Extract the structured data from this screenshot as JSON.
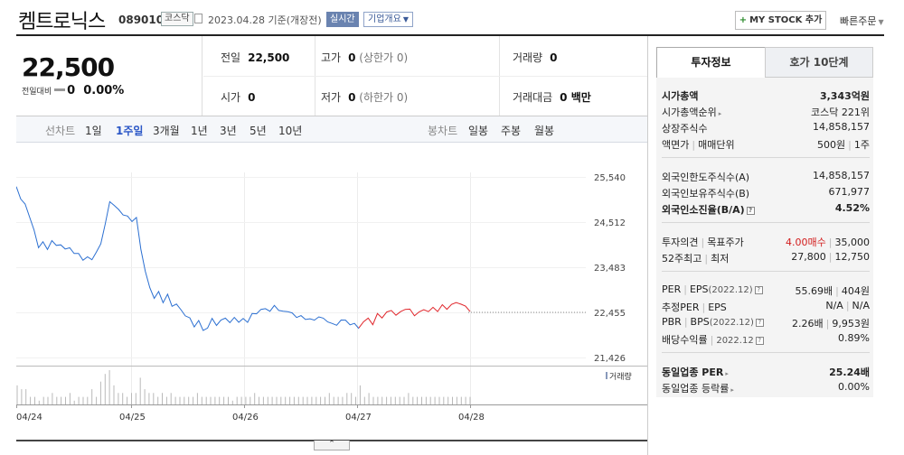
{
  "header": {
    "title": "켐트로닉스",
    "code": "089010",
    "market": "코스닥",
    "date": "2023.04.28 기준(개장전)",
    "realtime": "실시간",
    "corp_info": "기업개요",
    "mystock": "MY STOCK 추가",
    "quick": "빠른주문"
  },
  "summary": {
    "price": "22,500",
    "change_label": "전일대비",
    "change_value": "0",
    "change_pct": "0.00%",
    "prev_label": "전일",
    "prev": "22,500",
    "high_label": "고가",
    "high": "0",
    "high_sub": "(상한가 0)",
    "volume_label": "거래량",
    "volume": "0",
    "open_label": "시가",
    "open": "0",
    "low_label": "저가",
    "low": "0",
    "low_sub": "(하한가 0)",
    "amount_label": "거래대금",
    "amount": "0 백만"
  },
  "periods": {
    "line_label": "선차트",
    "items": [
      "1일",
      "1주일",
      "3개월",
      "1년",
      "3년",
      "5년",
      "10년"
    ],
    "selected": "1주일",
    "candle_label": "봉차트",
    "candle_items": [
      "일봉",
      "주봉",
      "월봉"
    ]
  },
  "chart_data": {
    "type": "line",
    "y_ticks": [
      "25,540",
      "24,512",
      "23,483",
      "22,455",
      "21,426"
    ],
    "ylim": [
      21426,
      25540
    ],
    "x_ticks": [
      "04/24",
      "04/25",
      "04/26",
      "04/27",
      "04/28"
    ],
    "volume_label": "거래량",
    "reference_line": 22455,
    "series": [
      {
        "color": "#2b6fd1",
        "values": [
          25320,
          25050,
          24900,
          24650,
          24300,
          23950,
          24050,
          23890,
          24100,
          23960,
          24020,
          23870,
          23950,
          23780,
          23800,
          23650,
          23700,
          23680,
          23800,
          24040,
          24450,
          24980,
          24900,
          24780,
          24700,
          24620,
          24550,
          24600,
          23900,
          23400,
          23000,
          22800,
          22900,
          22700,
          22850,
          22600,
          22650,
          22500,
          22400,
          22300,
          22150,
          22250,
          22050,
          22100,
          22300,
          22180,
          22250,
          22350,
          22200,
          22350,
          22230,
          22300,
          22250,
          22400,
          22450,
          22500,
          22550,
          22480,
          22600,
          22520,
          22450,
          22500,
          22420,
          22350,
          22380,
          22280,
          22330,
          22250,
          22380,
          22300,
          22250,
          22200,
          22150,
          22300,
          22250,
          22200,
          22180,
          22100
        ]
      },
      {
        "color": "#e0252a",
        "values": [
          22100,
          22250,
          22300,
          22200,
          22400,
          22350,
          22450,
          22500,
          22400,
          22450,
          22550,
          22500,
          22400,
          22450,
          22520,
          22480,
          22550,
          22500,
          22600,
          22550,
          22620,
          22680,
          22650,
          22580,
          22500
        ]
      }
    ],
    "volume": [
      5,
      4,
      4,
      2,
      2,
      1,
      2,
      2,
      3,
      2,
      2,
      2,
      3,
      1,
      2,
      2,
      2,
      4,
      2,
      6,
      8,
      9,
      5,
      3,
      3,
      2,
      3,
      3,
      7,
      4,
      3,
      3,
      2,
      3,
      2,
      3,
      2,
      2,
      2,
      2,
      2,
      3,
      2,
      2,
      2,
      2,
      2,
      2,
      2,
      1,
      2,
      2,
      2,
      2,
      3,
      2,
      2,
      2,
      2,
      2,
      2,
      2,
      2,
      2,
      2,
      2,
      2,
      2,
      2,
      2,
      2,
      3,
      2,
      2,
      2,
      3,
      3,
      2,
      5,
      2,
      3,
      2,
      2,
      2,
      2,
      2,
      2,
      2,
      2,
      3,
      2,
      2,
      2,
      2,
      2,
      2,
      2,
      2,
      2,
      2,
      2,
      2,
      2,
      2
    ]
  },
  "right_panel": {
    "tabs": [
      "투자정보",
      "호가 10단계"
    ],
    "rows": [
      {
        "k": "시가총액",
        "v": "3,343억원",
        "bold": true
      },
      {
        "k": "시가총액순위",
        "v": "코스닥 221위"
      },
      {
        "k": "상장주식수",
        "v": "14,858,157"
      },
      {
        "k": "액면가",
        "k2": "매매단위",
        "v": "500원",
        "v2": "1주"
      },
      {
        "k": "외국인한도주식수(A)",
        "v": "14,858,157"
      },
      {
        "k": "외국인보유주식수(B)",
        "v": "671,977"
      },
      {
        "k": "외국인소진율(B/A)",
        "v": "4.52%",
        "bold": true
      },
      {
        "k": "투자의견",
        "k2": "목표주가",
        "v": "4.00매수",
        "v2": "35,000"
      },
      {
        "k": "52주최고",
        "k2": "최저",
        "v": "27,800",
        "v2": "12,750"
      },
      {
        "k": "PER",
        "k2": "EPS",
        "k2sub": "(2022.12)",
        "v": "55.69배",
        "v2": "404원"
      },
      {
        "k": "추정PER",
        "k2": "EPS",
        "v": "N/A",
        "v2": "N/A"
      },
      {
        "k": "PBR",
        "k2": "BPS",
        "k2sub": "(2022.12)",
        "v": "2.26배",
        "v2": "9,953원"
      },
      {
        "k": "배당수익률",
        "k2sub": "2022.12",
        "v": "0.89%"
      },
      {
        "k": "동일업종 PER",
        "v": "25.24배",
        "bold": true
      },
      {
        "k": "동일업종 등락률",
        "v": "0.00%"
      }
    ]
  }
}
